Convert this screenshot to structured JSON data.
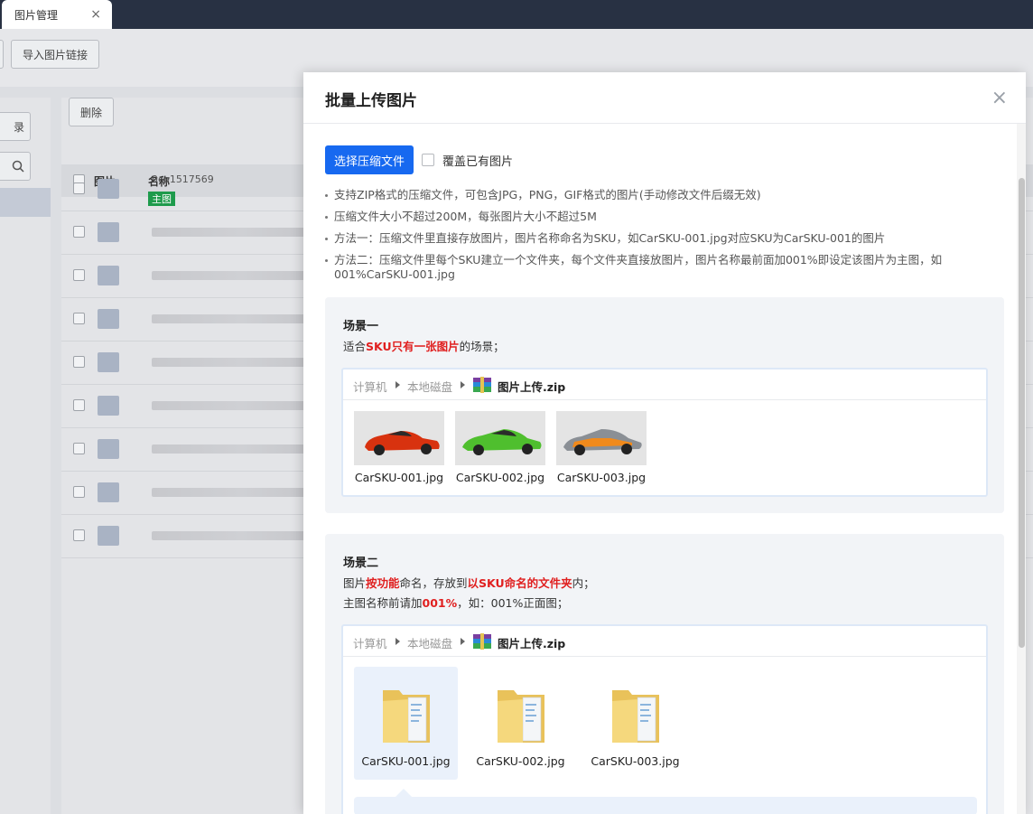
{
  "tabs": [
    {
      "label": "图片管理",
      "close": "×"
    }
  ],
  "background": {
    "toolbar": {
      "import_label": "导入图片链接"
    },
    "left": {
      "btn_label": "录"
    },
    "delete_label": "删除",
    "table": {
      "headers": [
        "图片",
        "名称"
      ],
      "first_row_tag": "主图",
      "first_row_text": "9ce1517569"
    }
  },
  "modal": {
    "title": "批量上传图片",
    "close": "×",
    "upload_button": "选择压缩文件",
    "overwrite_label": "覆盖已有图片",
    "notes": [
      "支持ZIP格式的压缩文件，可包含JPG，PNG，GIF格式的图片(手动修改文件后缀无效)",
      "压缩文件大小不超过200M，每张图片大小不超过5M",
      "方法一：压缩文件里直接存放图片，图片名称命名为SKU，如CarSKU-001.jpg对应SKU为CarSKU-001的图片",
      "方法二：压缩文件里每个SKU建立一个文件夹，每个文件夹直接放图片，图片名称最前面加001%即设定该图片为主图，如001%CarSKU-001.jpg"
    ],
    "scene1": {
      "title": "场景一",
      "desc_prefix": "适合",
      "desc_highlight": "SKU只有一张图片",
      "desc_suffix": "的场景；",
      "path": [
        "计算机",
        "本地磁盘",
        "图片上传.zip"
      ],
      "files": [
        "CarSKU-001.jpg",
        "CarSKU-002.jpg",
        "CarSKU-003.jpg"
      ]
    },
    "scene2": {
      "title": "场景二",
      "line1_prefix": "图片",
      "line1_hl1": "按功能",
      "line1_mid": "命名，存放到",
      "line1_hl2": "以SKU命名的文件夹",
      "line1_suffix": "内；",
      "line2_prefix": "主图名称前请加",
      "line2_hl": "001%",
      "line2_suffix": "，如：001%正面图；",
      "path": [
        "计算机",
        "本地磁盘",
        "图片上传.zip"
      ],
      "folders": [
        "CarSKU-001.jpg",
        "CarSKU-002.jpg",
        "CarSKU-003.jpg"
      ]
    }
  },
  "colors": {
    "primary": "#1769f0",
    "highlight": "#e02020",
    "header_bar": "#283143"
  }
}
